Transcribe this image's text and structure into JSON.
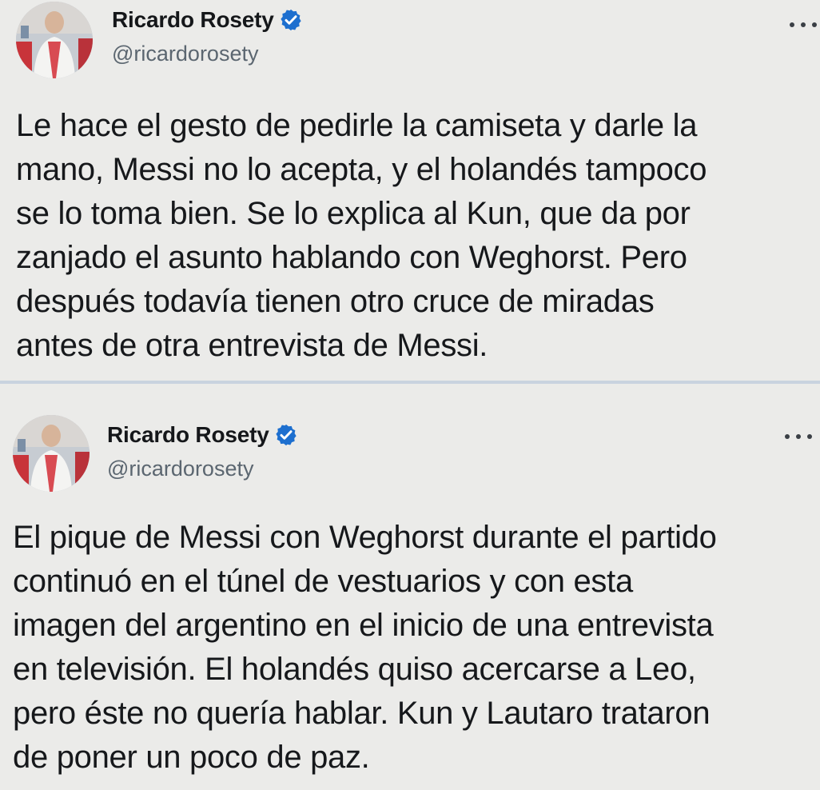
{
  "tweets": [
    {
      "author": {
        "name": "Ricardo Rosety",
        "handle": "@ricardorosety",
        "avatar_icon": "profile-photo",
        "verified_icon": "verified-badge-icon",
        "verified_color": "#1d9bf0"
      },
      "more_icon": "more-options-icon",
      "text_lines": [
        "Le hace el gesto de pedirle la camiseta y darle la",
        "mano, Messi no lo acepta, y el holandés tampoco",
        "se lo toma bien. Se lo explica al Kun, que da por",
        "zanjado el asunto hablando con Weghorst. Pero",
        "después todavía tienen otro cruce de miradas",
        "antes de otra entrevista de Messi."
      ]
    },
    {
      "author": {
        "name": "Ricardo Rosety",
        "handle": "@ricardorosety",
        "avatar_icon": "profile-photo",
        "verified_icon": "verified-badge-icon",
        "verified_color": "#1d9bf0"
      },
      "more_icon": "more-options-icon",
      "text_lines": [
        "El pique de Messi con Weghorst durante el partido",
        "continuó en el túnel de vestuarios y con esta",
        "imagen del argentino en el inicio de una entrevista",
        "en televisión. El holandés quiso acercarse a Leo,",
        "pero éste no quería hablar. Kun y Lautaro trataron",
        "de poner un poco de paz."
      ]
    }
  ]
}
